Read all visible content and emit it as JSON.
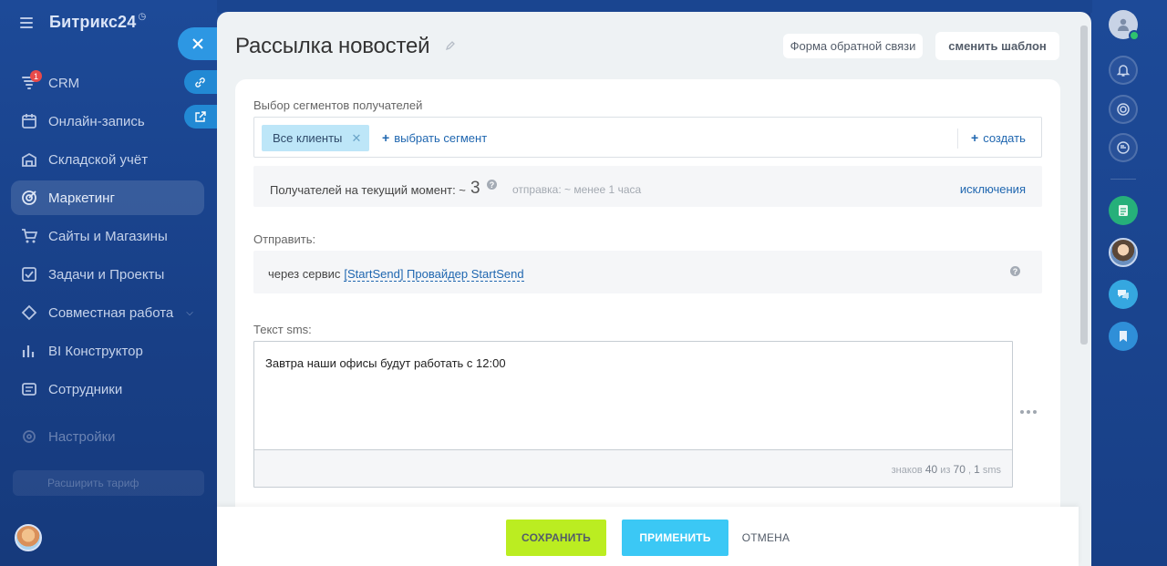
{
  "app": {
    "logo": "Битрикс24",
    "logo_mark": "◷"
  },
  "sidebar": {
    "items": [
      {
        "label": "CRM",
        "badge": "1"
      },
      {
        "label": "Онлайн-запись"
      },
      {
        "label": "Складской учёт"
      },
      {
        "label": "Маркетинг"
      },
      {
        "label": "Сайты и Магазины"
      },
      {
        "label": "Задачи и Проекты"
      },
      {
        "label": "Совместная работа"
      },
      {
        "label": "BI Конструктор"
      },
      {
        "label": "Сотрудники"
      },
      {
        "label": "Настройки"
      }
    ],
    "tariff_label": "Расширить тариф"
  },
  "slider": {
    "title": "Рассылка новостей",
    "feedback_button": "Форма обратной связи",
    "template_button": "сменить шаблон",
    "segments": {
      "label": "Выбор сегментов получателей",
      "chip": "Все клиенты",
      "select_link": "выбрать сегмент",
      "create_link": "создать"
    },
    "recipients": {
      "text": "Получателей на текущий момент: ~",
      "count": "3",
      "eta": "отправка: ~ менее 1 часа",
      "exclusions_link": "исключения"
    },
    "send": {
      "label": "Отправить:",
      "via_text": "через сервис",
      "provider_link": "[StartSend] Провайдер StartSend"
    },
    "sms": {
      "label": "Текст sms:",
      "value": "Завтра наши офисы будут работать с 12:00",
      "counter_prefix": "знаков",
      "chars": "40",
      "of": "из",
      "max": "70",
      "sep": ",",
      "sms_count": "1",
      "sms_word": "sms"
    }
  },
  "footer": {
    "save": "СОХРАНИТЬ",
    "apply": "ПРИМЕНИТЬ",
    "cancel": "ОТМЕНА"
  },
  "colors": {
    "save": "#bbed21",
    "apply": "#3bc8f5",
    "link": "#2067b0",
    "chip": "#bde6f8"
  }
}
